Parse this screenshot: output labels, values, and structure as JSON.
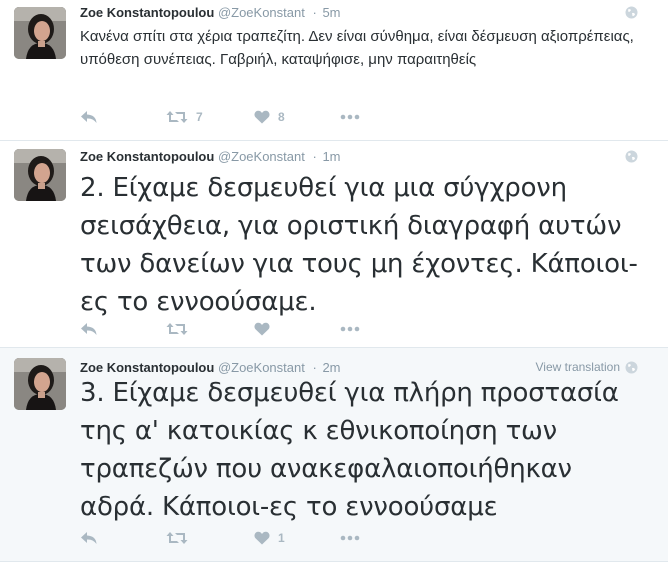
{
  "colors": {
    "text": "#292f33",
    "muted": "#8899a6",
    "action_icon": "#aab8c2",
    "highlight_background": "#f5f8fa",
    "divider": "#e1e8ed"
  },
  "tweets": [
    {
      "fullname": "Zoe Konstantopoulou",
      "handle": "@ZoeKonstant",
      "separator": "·",
      "time": "5m",
      "text": "Κανένα σπίτι στα χέρια τραπεζίτη. Δεν είναι σύνθημα, είναι δέσμευση αξιοπρέπειας, υπόθεση συνέπειας. Γαβριήλ, καταψήφισε, μην παραιτηθείς",
      "corner_icon": "globe-icon",
      "retweets": "7",
      "likes": "8"
    },
    {
      "fullname": "Zoe Konstantopoulou",
      "handle": "@ZoeKonstant",
      "separator": "·",
      "time": "1m",
      "text": "2. Είχαμε δεσμευθεί για μια σύγχρονη σεισάχθεια, για οριστική διαγραφή αυτών των δανείων για τους μη έχοντες. Κάποιοι-ες το εννοούσαμε.",
      "corner_icon": "globe-icon",
      "retweets": "",
      "likes": ""
    },
    {
      "fullname": "Zoe Konstantopoulou",
      "handle": "@ZoeKonstant",
      "separator": "·",
      "time": "2m",
      "text": "3. Είχαμε δεσμευθεί για πλήρη προστασία της α' κατοικίας κ εθνικοποίηση των τραπεζών που ανακεφαλαιοποιήθηκαν αδρά. Κάποιοι-ες το εννοούσαμε",
      "corner_label": "View translation",
      "corner_icon": "globe-icon",
      "retweets": "",
      "likes": "1"
    }
  ]
}
